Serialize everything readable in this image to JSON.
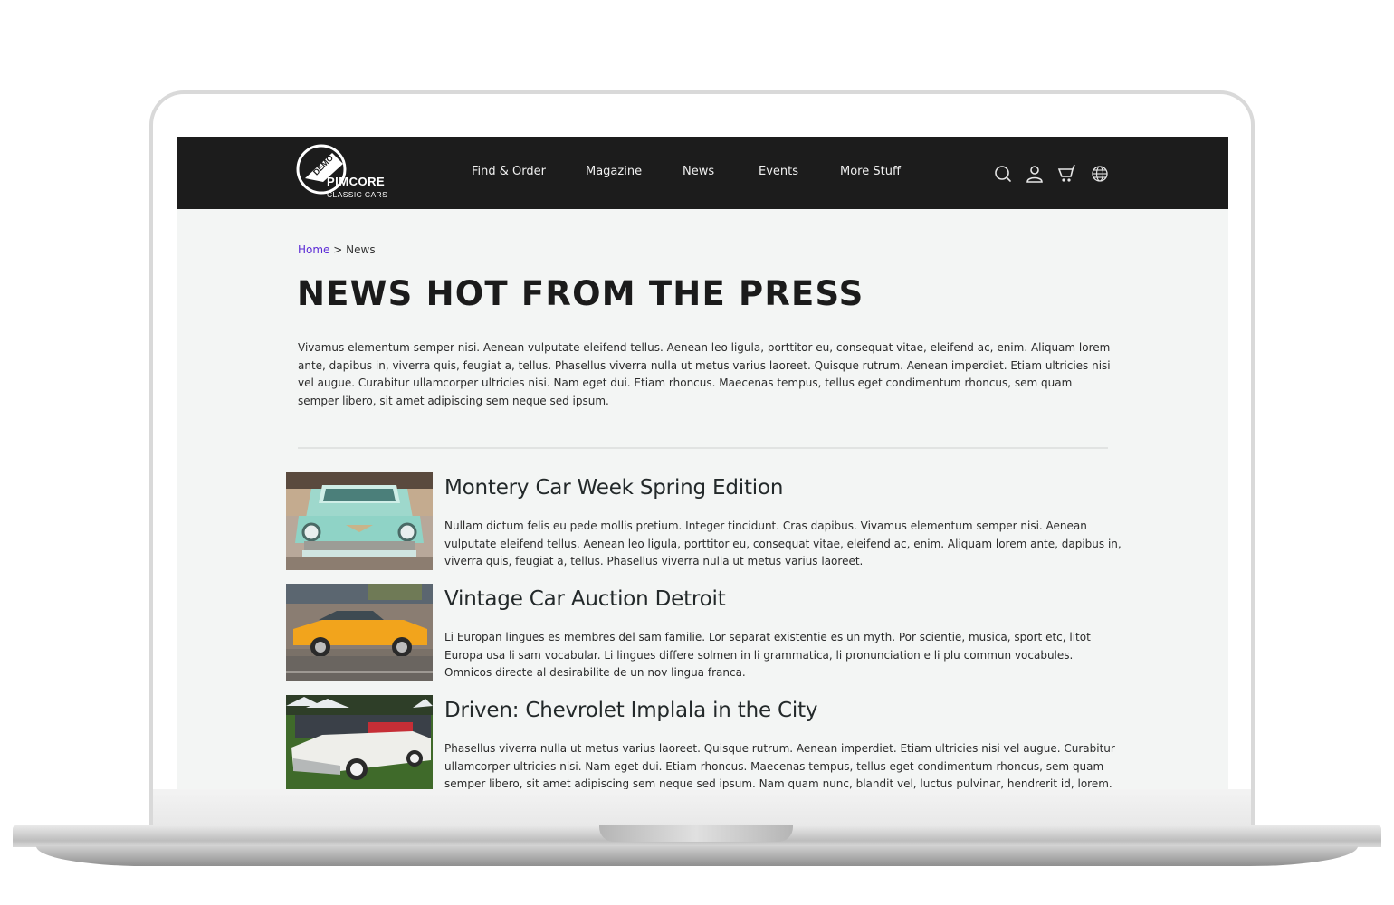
{
  "brand": {
    "badge": "DEMO",
    "name": "PIMCORE",
    "subtitle": "CLASSIC CARS"
  },
  "nav": {
    "items": [
      {
        "label": "Find & Order"
      },
      {
        "label": "Magazine"
      },
      {
        "label": "News"
      },
      {
        "label": "Events"
      },
      {
        "label": "More Stuff"
      }
    ],
    "icons": [
      "search-icon",
      "user-icon",
      "cart-icon",
      "globe-icon"
    ]
  },
  "breadcrumb": {
    "home": "Home",
    "separator": ">",
    "current": "News"
  },
  "page": {
    "title": "NEWS HOT FROM THE PRESS",
    "intro": "Vivamus elementum semper nisi. Aenean vulputate eleifend tellus. Aenean leo ligula, porttitor eu, consequat vitae, eleifend ac, enim. Aliquam lorem ante, dapibus in, viverra quis, feugiat a, tellus. Phasellus viverra nulla ut metus varius laoreet. Quisque rutrum. Aenean imperdiet. Etiam ultricies nisi vel augue. Curabitur ullamcorper ultricies nisi. Nam eget dui. Etiam rhoncus. Maecenas tempus, tellus eget condimentum rhoncus, sem quam semper libero, sit amet adipiscing sem neque sed ipsum."
  },
  "news": [
    {
      "title": "Montery Car Week Spring Edition",
      "body": "Nullam dictum felis eu pede mollis pretium. Integer tincidunt. Cras dapibus. Vivamus elementum semper nisi. Aenean vulputate eleifend tellus. Aenean leo ligula, porttitor eu, consequat vitae, eleifend ac, enim. Aliquam lorem ante, dapibus in, viverra quis, feugiat a, tellus. Phasellus viverra nulla ut metus varius laoreet.",
      "image": "turquoise classic car front view"
    },
    {
      "title": "Vintage Car Auction Detroit",
      "body": "Li Europan lingues es membres del sam familie. Lor separat existentie es un myth. Por scientie, musica, sport etc, litot Europa usa li sam vocabular. Li lingues differe solmen in li grammatica, li pronunciation e li plu commun vocabules. Omnicos directe al desirabilite de un nov lingua franca.",
      "image": "orange classic sports car side view"
    },
    {
      "title": "Driven: Chevrolet Implala in the City",
      "body": "Phasellus viverra nulla ut metus varius laoreet. Quisque rutrum. Aenean imperdiet. Etiam ultricies nisi vel augue. Curabitur ullamcorper ultricies nisi. Nam eget dui. Etiam rhoncus. Maecenas tempus, tellus eget condimentum rhoncus, sem quam semper libero, sit amet adipiscing sem neque sed ipsum. Nam quam nunc, blandit vel, luctus pulvinar, hendrerit id, lorem. Maecenas nec odio et ante tincidunt",
      "image": "white classic convertible on grass"
    }
  ],
  "colors": {
    "navbar": "#1c1c1c",
    "background": "#f3f5f4",
    "link": "#5b2ad6",
    "text": "#2b2b2b"
  }
}
